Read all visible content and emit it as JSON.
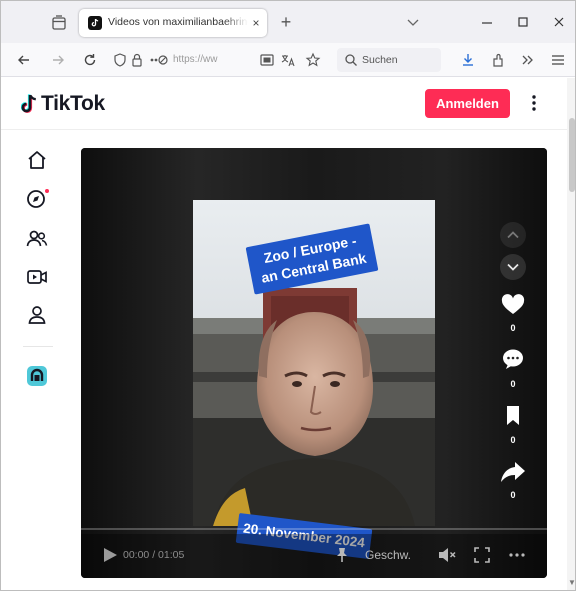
{
  "browser": {
    "tab_title": "Videos von maximilianbaehring",
    "tab_close_glyph": "×",
    "new_tab_glyph": "+",
    "url_text": "https://ww",
    "search_placeholder": "Suchen",
    "window_controls": [
      "minimize-icon",
      "maximize-icon",
      "close-icon"
    ],
    "toolbar_icons": [
      "back-icon",
      "forward-icon",
      "reload-icon",
      "shield-icon",
      "lock-icon",
      "permissions-icon",
      "reader-icon",
      "translate-icon",
      "bookmark-star-icon",
      "search-icon",
      "download-icon",
      "extensions-icon",
      "overflow-icon",
      "menu-icon"
    ]
  },
  "tiktok": {
    "logo_text": "TikTok",
    "login_label": "Anmelden",
    "sidebar_icons": [
      "home-icon",
      "explore-icon",
      "following-icon",
      "live-icon",
      "profile-icon",
      "app-icon"
    ],
    "accent": "#fe2c55"
  },
  "video": {
    "caption_top_line1": "Zoo / Europe -",
    "caption_top_line2": "an Central Bank",
    "caption_bottom": "20. November 2024",
    "time": "00:00 / 01:05",
    "speed_label": "Geschw.",
    "actions": {
      "like_count": "0",
      "comment_count": "0",
      "save_count": "0",
      "share_count": "0"
    },
    "caption_color": "#1f56c9"
  }
}
